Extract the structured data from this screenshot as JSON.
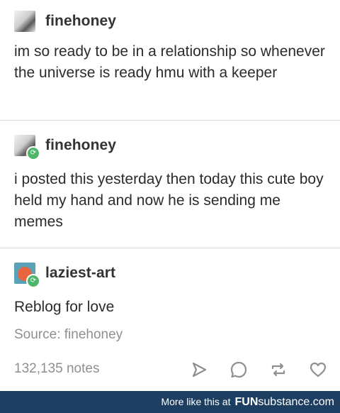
{
  "posts": [
    {
      "username": "finehoney",
      "text": "im so ready to be in a relationship so whenever the universe is ready hmu with a keeper",
      "avatar_icon": "photo-avatar",
      "reblog_badge": false
    },
    {
      "username": "finehoney",
      "text": "i posted this yesterday then today this cute boy held my hand and now he is sending me memes",
      "avatar_icon": "photo-avatar",
      "reblog_badge": true
    },
    {
      "username": "laziest-art",
      "text": "Reblog for love",
      "avatar_icon": "art-avatar",
      "reblog_badge": true
    }
  ],
  "source": "Source: finehoney",
  "notes": "132,135 notes",
  "actions": [
    "share-icon",
    "reply-icon",
    "reblog-icon",
    "heart-icon"
  ],
  "footer": {
    "text": "More like this at",
    "brand_bold": "FUN",
    "brand_rest": "substance.com"
  },
  "colors": {
    "footer_bg": "#1c3e60",
    "reblog_green": "#4fb56a",
    "muted_text": "#8f8f8f"
  }
}
